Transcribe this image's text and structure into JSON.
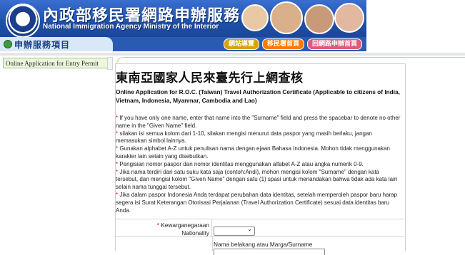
{
  "header": {
    "title_cn": "內政部移民署網路申辦服務",
    "title_en": "National Immigration Agency Ministry of the Interior",
    "menu_label": "申辦服務項目",
    "links": [
      "網站導覽",
      "移民署首頁",
      "回網路申辦首頁"
    ]
  },
  "sidebar": {
    "items": [
      {
        "label": "Online Application for Entry Permit"
      }
    ]
  },
  "main": {
    "title": "東南亞國家人民來臺先行上網查核",
    "subtitle": "Online Application for R.O.C. (Taiwan) Travel Authorization Certificate (Applicable to citizens of India, Vietnam, Indonesia, Myanmar, Cambodia and Lao)",
    "notes": [
      "If you have only one name, enter that name into the \"Surname\" field and press the spacebar to denote no other name in the \"Given Name\" field.",
      "silakan isi semua kolom dari 1-10, silakan mengisi menurut data paspor yang masih berlaku, jangan memasukan simbol lainnya.",
      "Gunakan alphabet A-Z untuk penulisan nama dengan ejaan Bahasa Indonesia. Mohon tidak menggunakan karakter lain selain yang disebutkan.",
      "Pengisian nomor paspor dan nomor identitas menggunakan alfabet A-Z atau angka numerik 0-9.",
      "Jika nama terdiri dari satu suku kata saja (contoh:Andi), mohon mengisi kolom \"Surname\" dengan kata tersebut, dan mengisi kolom \"Given Name\" dengan satu (1) spasi untuk menandakan bahwa tidak ada kata lain selain nama tunggal tersebut.",
      "Jika dalam paspor Indonesia Anda terdapat perubahan data identitas, setelah memperoleh paspor baru harap segera isi Surat Keterangan Otorisasi Perjalanan (Travel Authorization Certificate) sesuai data identitas baru Anda."
    ],
    "form": {
      "nationality_label_id": "Kewarganegaraan",
      "nationality_label_en": "Nationality",
      "nationality_value": "",
      "surname_label": "Nama belakang atau Marga/Surname"
    }
  }
}
